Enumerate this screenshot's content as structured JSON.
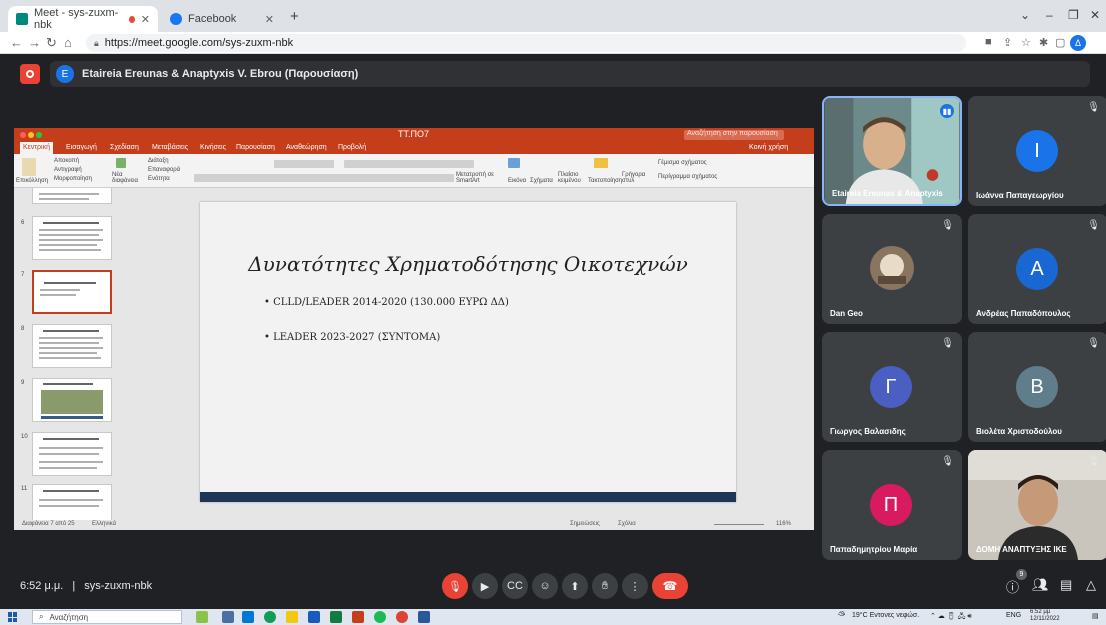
{
  "browser": {
    "tabs": [
      {
        "title": "Meet - sys-zuxm-nbk",
        "active": true,
        "favicon_color": "#00897b"
      },
      {
        "title": "Facebook",
        "active": false,
        "favicon_color": "#1877f2"
      }
    ],
    "new_tab": "+",
    "url": "https://meet.google.com/sys-zuxm-nbk",
    "profile_letter": "Δ"
  },
  "meet": {
    "presenter_initial": "E",
    "presentation_title": "Etaireia Ereunas & Anaptyxis V. Ebrou (Παρουσίαση)",
    "clock": "6:52 μ.μ.",
    "separator": "|",
    "meeting_code": "sys-zuxm-nbk",
    "people_count": "9"
  },
  "powerpoint": {
    "file_name": "ΤΤ.ΠΟ7",
    "search_placeholder": "Αναζήτηση στην παρουσίαση",
    "tabs": [
      "Κεντρική",
      "Εισαγωγή",
      "Σχεδίαση",
      "Μεταβάσεις",
      "Κινήσεις",
      "Παρουσίαση",
      "Αναθεώρηση",
      "Προβολή"
    ],
    "share_label": "Κοινή χρήση",
    "ribbon": {
      "paste": "Επικόλληση",
      "cut": "Αποκοπή",
      "copy": "Αντιγραφή",
      "format": "Μορφοποίηση",
      "new_slide": "Νέα διαφάνεια",
      "layout": "Διάταξη",
      "reset": "Επαναφορά",
      "section": "Ενότητα",
      "convert": "Μετατροπή σε SmartArt",
      "picture": "Εικόνα",
      "shapes": "Σχήματα",
      "textbox": "Πλαίσιο κειμένου",
      "arrange": "Τακτοποίηση",
      "quick_styles": "Γρήγορα στυλ",
      "shape_fill": "Γέμισμα σχήματος",
      "shape_outline": "Περίγραμμα σχήματος"
    },
    "thumb_numbers": [
      "6",
      "7",
      "8",
      "9",
      "10",
      "11"
    ],
    "slide": {
      "heading": "Δυνατότητες Χρηματοδότησης Οικοτεχνών",
      "bullets": [
        "CLLD/LEADER 2014-2020 (130.000 ΕΥΡΩ ΔΔ)",
        "LEADER   2023-2027 (ΣΥΝΤΟΜΑ)"
      ]
    },
    "status": {
      "slide_counter": "Διαφάνεια 7 από 25",
      "language": "Ελληνικά",
      "notes": "Σημειώσεις",
      "comments": "Σχόλια",
      "zoom": "116%"
    }
  },
  "participants": [
    {
      "name": "Etaireia Ereunas & Anaptyxis",
      "initial": "",
      "color": "",
      "kind": "video",
      "active": true
    },
    {
      "name": "Ιωάννα Παπαγεωργίου",
      "initial": "Ι",
      "color": "#1a73e8",
      "kind": "avatar"
    },
    {
      "name": "Dan Geo",
      "initial": "",
      "color": "",
      "kind": "photo"
    },
    {
      "name": "Ανδρέας Παπαδόπουλος",
      "initial": "Α",
      "color": "#1967d2",
      "kind": "avatar"
    },
    {
      "name": "Γιωργος Βαλασιδης",
      "initial": "Γ",
      "color": "#4a5fc1",
      "kind": "avatar"
    },
    {
      "name": "Βιολέτα Χριστοδούλου",
      "initial": "Β",
      "color": "#607d8b",
      "kind": "avatar"
    },
    {
      "name": "Παπαδημητρίου Μαρία",
      "initial": "Π",
      "color": "#d81b60",
      "kind": "avatar"
    },
    {
      "name": "ΔΟΜΗ ΑΝΑΠΤΥΞΗΣ ΙΚΕ",
      "initial": "",
      "color": "",
      "kind": "video"
    }
  ],
  "taskbar": {
    "search_placeholder": "Αναζήτηση",
    "weather": "19°C  Εντονες νεφώσ.",
    "lang": "ENG",
    "time": "6:52 μμ",
    "date": "12/11/2022"
  },
  "colors": {
    "meet_bg": "#202124",
    "tile_bg": "#3c4043",
    "pp_accent": "#c43e1c",
    "hangup": "#ea4335",
    "active_speaker": "#8ab4f8"
  }
}
